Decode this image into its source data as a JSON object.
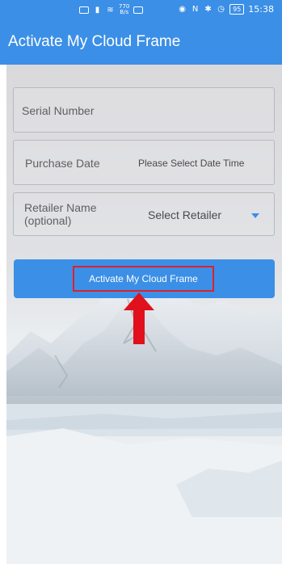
{
  "status_bar": {
    "speed_top": "770",
    "speed_bottom": "B/s",
    "battery": "95",
    "time": "15:38"
  },
  "app_bar": {
    "title": "Activate My Cloud Frame"
  },
  "form": {
    "serial": {
      "label": "Serial Number"
    },
    "purchase_date": {
      "label": "Purchase Date",
      "value": "Please Select Date Time"
    },
    "retailer": {
      "label": "Retailer Name (optional)",
      "value": "Select Retailer"
    }
  },
  "activate_button": {
    "label": "Activate My Cloud Frame"
  },
  "icons": {
    "dropdown": "chevron-down-icon",
    "annotation": "arrow-up-icon"
  },
  "colors": {
    "accent": "#3b8fe6",
    "highlight": "#e0202a"
  }
}
